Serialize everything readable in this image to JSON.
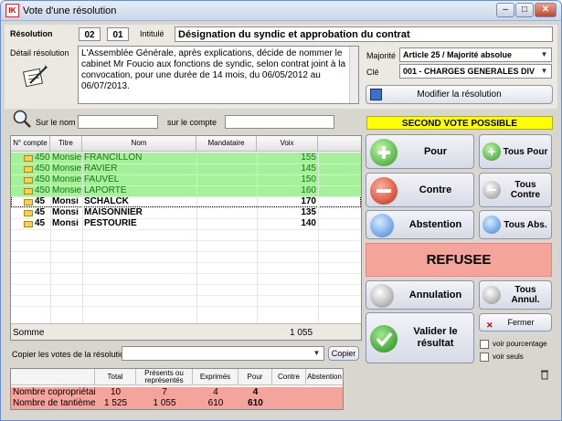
{
  "window": {
    "title": "Vote d'une résolution",
    "app_icon": "IK"
  },
  "resolution": {
    "label": "Résolution",
    "num1": "02",
    "num2": "01",
    "intitule_label": "Intitulé",
    "intitule": "Désignation du syndic et approbation du contrat",
    "detail_label": "Détail résolution",
    "detail": "L'Assemblée Générale, après explications, décide de nommer le cabinet Mr Foucio aux fonctions de syndic, selon contrat joint à la convocation, pour une durée de 14 mois, du 06/05/2012 au 06/07/2013."
  },
  "majorite": {
    "label": "Majorité",
    "value": "Article 25 / Majorité absolue"
  },
  "cle": {
    "label": "Clé",
    "value": "001 - CHARGES GENERALES DIV"
  },
  "modify_button": "Modifier la résolution",
  "search": {
    "nom_label": "Sur le nom",
    "compte_label": "sur le compte"
  },
  "second_vote": "SECOND VOTE POSSIBLE",
  "grid": {
    "headers": [
      "N° compte",
      "Titre",
      "Nom",
      "Mandataire",
      "Voix"
    ],
    "rows": [
      {
        "compte": "450",
        "titre": "Monsie",
        "nom": "FRANCILLON",
        "mandataire": "",
        "voix": "155",
        "style": "green"
      },
      {
        "compte": "450",
        "titre": "Monsie",
        "nom": "RAVIER",
        "mandataire": "",
        "voix": "145",
        "style": "green"
      },
      {
        "compte": "450",
        "titre": "Monsie",
        "nom": "FAUVEL",
        "mandataire": "",
        "voix": "150",
        "style": "green"
      },
      {
        "compte": "450",
        "titre": "Monsie",
        "nom": "LAPORTE",
        "mandataire": "",
        "voix": "160",
        "style": "green"
      },
      {
        "compte": "45",
        "titre": "Monsi",
        "nom": "SCHALCK",
        "mandataire": "",
        "voix": "170",
        "style": "selected"
      },
      {
        "compte": "45",
        "titre": "Monsi",
        "nom": "MAISONNIER",
        "mandataire": "",
        "voix": "135",
        "style": "white"
      },
      {
        "compte": "45",
        "titre": "Monsi",
        "nom": "PESTOURIE",
        "mandataire": "",
        "voix": "140",
        "style": "white"
      }
    ],
    "sum_label": "Somme",
    "sum_value": "1 055"
  },
  "copy": {
    "label": "Copier les votes de la résolution",
    "button": "Copier"
  },
  "buttons": {
    "pour": "Pour",
    "tous_pour": "Tous Pour",
    "contre": "Contre",
    "tous_contre": "Tous Contre",
    "abstention": "Abstention",
    "tous_abs": "Tous Abs.",
    "annulation": "Annulation",
    "tous_annul": "Tous Annul.",
    "valider": "Valider le résultat",
    "fermer": "Fermer"
  },
  "result": "REFUSEE",
  "checkboxes": {
    "pourcentage": "voir pourcentage",
    "seuls": "voir seuls"
  },
  "bottom": {
    "headers": [
      "Total",
      "Présents ou représentés",
      "Exprimés",
      "Pour",
      "Contre",
      "Abstention"
    ],
    "rows": [
      {
        "label": "Nombre copropriétaires",
        "total": "10",
        "presents": "7",
        "exprimes": "4",
        "pour": "4",
        "contre": "",
        "abstention": ""
      },
      {
        "label": "Nombre de tantièmes",
        "total": "1 525",
        "presents": "1 055",
        "exprimes": "610",
        "pour": "610",
        "contre": "",
        "abstention": ""
      }
    ]
  },
  "colors": {
    "accent_yellow": "#ffff00",
    "green_row": "#a6f09b",
    "result_red": "#f4a49b",
    "green_text": "#167a10"
  }
}
